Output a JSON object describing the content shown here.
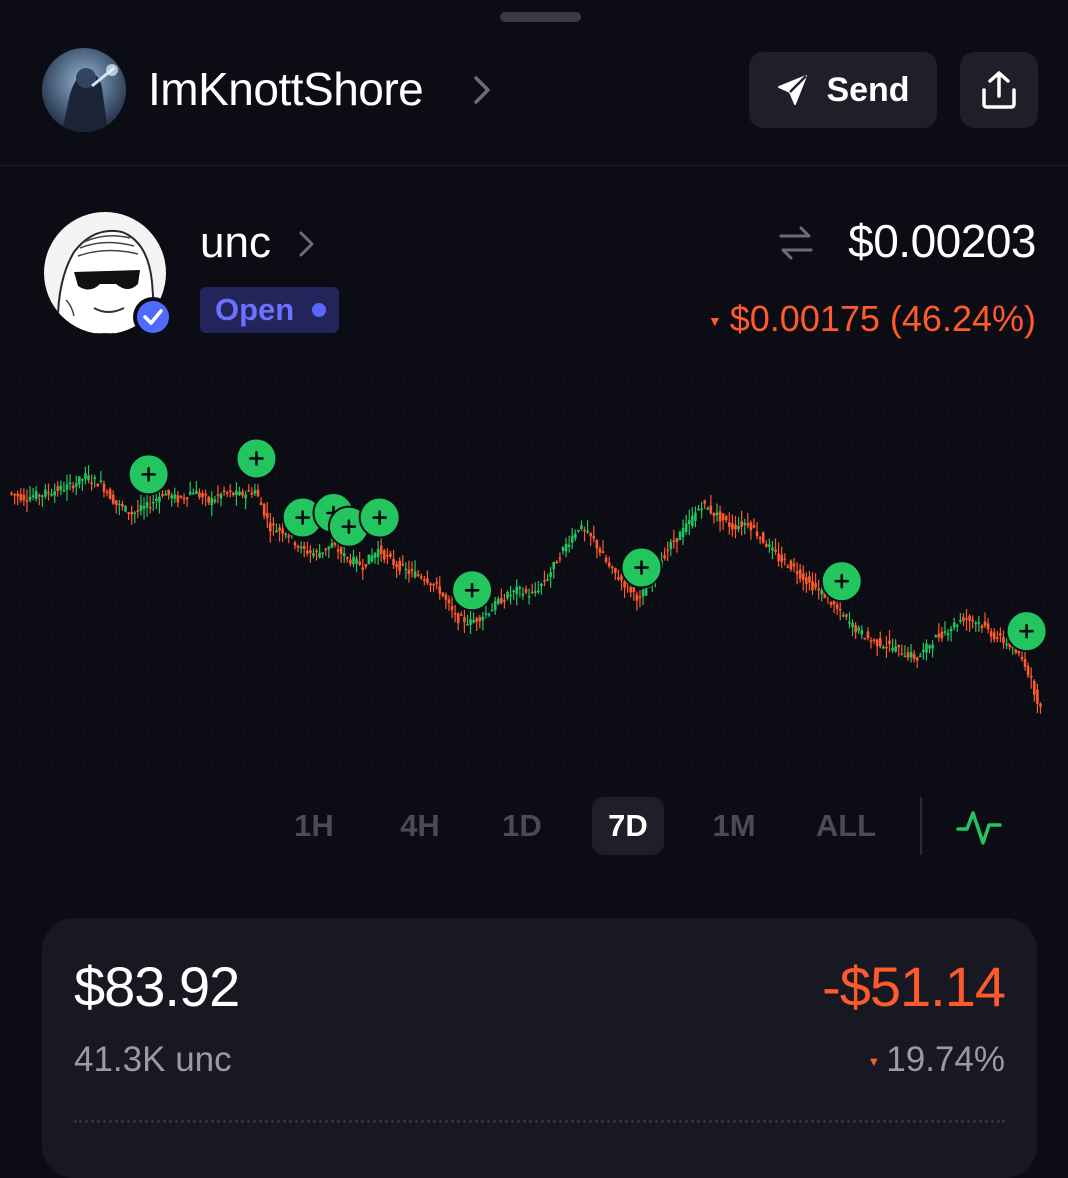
{
  "header": {
    "username": "ImKnottShore",
    "send_label": "Send"
  },
  "token": {
    "name": "unc",
    "status": "Open",
    "price": "$0.00203",
    "change": "$0.00175 (46.24%)"
  },
  "timeframes": [
    "1H",
    "4H",
    "1D",
    "7D",
    "1M",
    "ALL"
  ],
  "active_timeframe": "7D",
  "position": {
    "value": "$83.92",
    "quantity": "41.3K unc",
    "pnl": "-$51.14",
    "pnl_pct": "19.74%"
  },
  "colors": {
    "up": "#22c55e",
    "down": "#ff5a2c",
    "accent": "#5a66ff"
  },
  "chart_data": {
    "type": "line",
    "series": [
      {
        "values": [
          2.95,
          2.93,
          2.94,
          2.96,
          2.98,
          3.02,
          2.99,
          2.9,
          2.86,
          2.89,
          2.95,
          2.92,
          2.96,
          2.91,
          2.95,
          2.94,
          2.96,
          2.8,
          2.78,
          2.7,
          2.68,
          2.72,
          2.66,
          2.63,
          2.7,
          2.64,
          2.6,
          2.58,
          2.52,
          2.4,
          2.38,
          2.42,
          2.48,
          2.52,
          2.5,
          2.58,
          2.7,
          2.8,
          2.74,
          2.62,
          2.55,
          2.48,
          2.62,
          2.72,
          2.8,
          2.9,
          2.85,
          2.8,
          2.82,
          2.74,
          2.66,
          2.62,
          2.55,
          2.5,
          2.42,
          2.35,
          2.3,
          2.28,
          2.25,
          2.22,
          2.3,
          2.35,
          2.4,
          2.38,
          2.32,
          2.28,
          2.2,
          2.0
        ]
      }
    ],
    "buy_markers": [
      9,
      16,
      19,
      21,
      22,
      24,
      30,
      41,
      54,
      66
    ]
  }
}
